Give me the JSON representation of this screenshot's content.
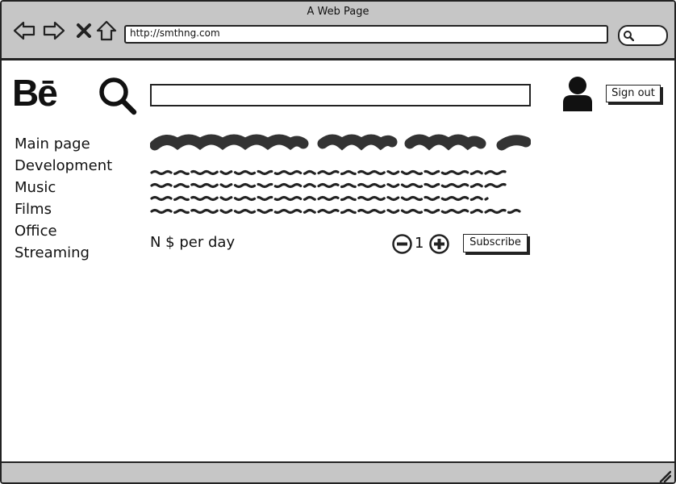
{
  "window": {
    "title": "A Web Page"
  },
  "browser": {
    "url": "http://smthng.com"
  },
  "header": {
    "logo_text": "Bē",
    "sign_out_label": "Sign out"
  },
  "sidebar": {
    "items": [
      {
        "label": "Main page"
      },
      {
        "label": "Development"
      },
      {
        "label": "Music"
      },
      {
        "label": "Films"
      },
      {
        "label": "Office"
      },
      {
        "label": "Streaming"
      }
    ]
  },
  "main": {
    "price_label": "N $ per day",
    "quantity": "1",
    "subscribe_label": "Subscribe"
  },
  "icons": {
    "back": "back-arrow-icon",
    "forward": "forward-arrow-icon",
    "stop": "close-icon",
    "home": "home-icon",
    "search": "search-icon",
    "user": "user-icon",
    "minus": "minus-circle-icon",
    "plus": "plus-circle-icon",
    "grip": "resize-grip-icon"
  },
  "colors": {
    "chrome": "#c6c6c6",
    "ink": "#222222",
    "background": "#ffffff"
  }
}
